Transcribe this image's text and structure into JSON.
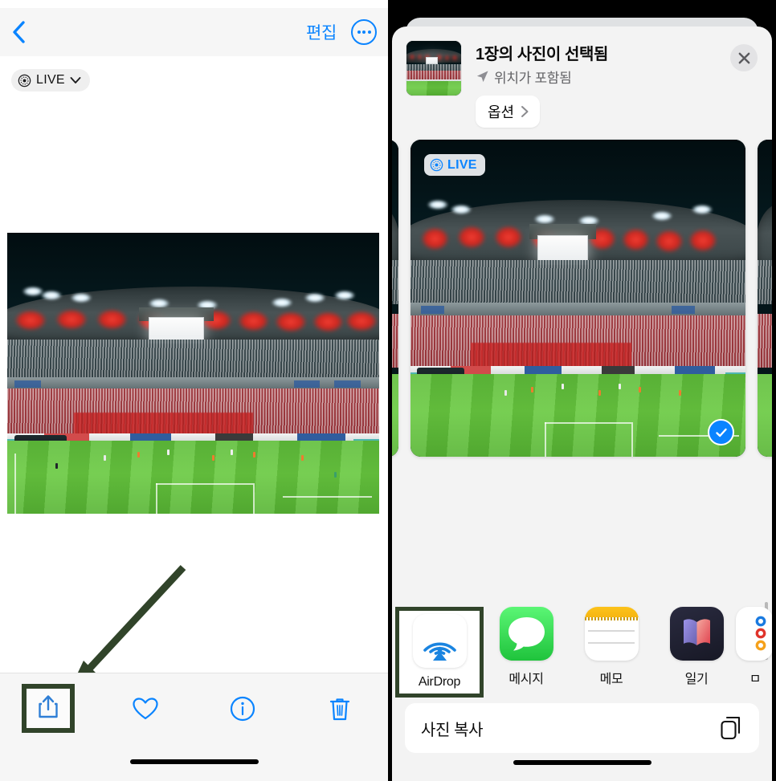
{
  "left_panel": {
    "nav": {
      "back_icon": "chevron-left-icon",
      "edit_label": "편집",
      "more_icon": "ellipsis-circle-icon"
    },
    "live_pill": {
      "icon": "live-photo-icon",
      "label": "LIVE",
      "chevron": "chevron-down-icon"
    },
    "photo": {
      "alt": "night football stadium with floodlights, red-lit roof panels, packed crowd and green striped pitch"
    },
    "annotation": {
      "arrow": "arrow-pointing-to-share-button",
      "color": "#31442a"
    },
    "toolbar": {
      "items": [
        {
          "name": "share-button",
          "icon": "share-icon",
          "highlighted": true
        },
        {
          "name": "favorite-button",
          "icon": "heart-icon",
          "highlighted": false
        },
        {
          "name": "info-button",
          "icon": "info-circle-icon",
          "highlighted": false
        },
        {
          "name": "delete-button",
          "icon": "trash-icon",
          "highlighted": false
        }
      ]
    }
  },
  "right_panel": {
    "share_sheet": {
      "header": {
        "thumbnail_alt": "stadium photo thumbnail",
        "title": "1장의 사진이 선택됨",
        "subtitle": "위치가 포함됨",
        "location_icon": "location-arrow-icon",
        "options_label": "옵션",
        "options_chevron": "chevron-right-icon",
        "close_icon": "close-icon"
      },
      "carousel": {
        "live_badge": "LIVE",
        "live_icon": "live-photo-icon",
        "selected_icon": "checkmark-circle-icon",
        "selected_count": 1
      },
      "apps": [
        {
          "label": "AirDrop",
          "icon": "airdrop-icon",
          "highlighted": true
        },
        {
          "label": "메시지",
          "icon": "messages-icon",
          "highlighted": false
        },
        {
          "label": "메모",
          "icon": "notes-icon",
          "highlighted": false
        },
        {
          "label": "일기",
          "icon": "journal-icon",
          "highlighted": false
        },
        {
          "label": "ㅁ",
          "icon": "mail-icon",
          "highlighted": false
        }
      ],
      "actions": [
        {
          "label": "사진 복사",
          "icon": "copy-icon"
        }
      ]
    }
  },
  "colors": {
    "accent_blue": "#0a84ff",
    "highlight_green": "#31442a",
    "sheet_background": "#f3f3f3",
    "nav_background": "#f6f6f6"
  }
}
